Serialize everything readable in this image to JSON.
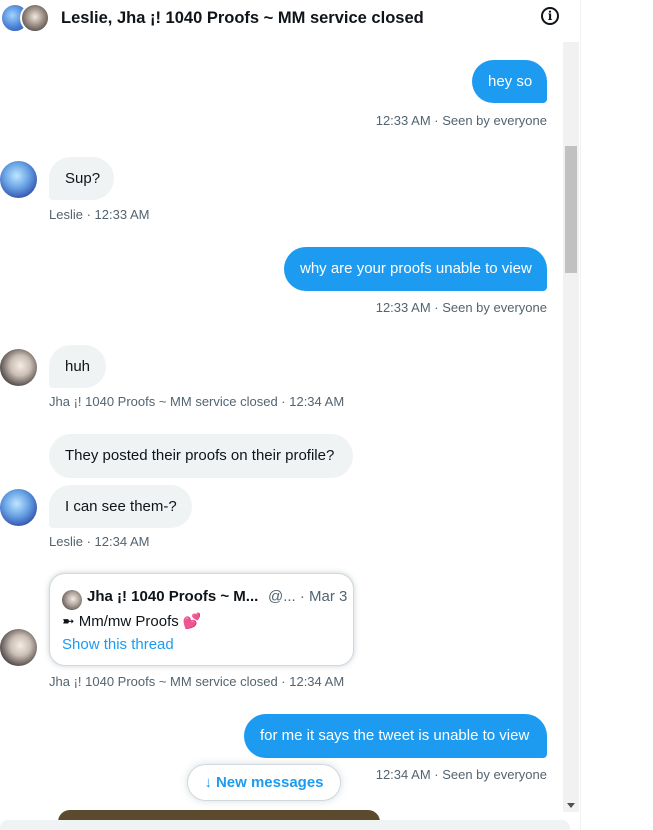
{
  "header": {
    "title": "Leslie, Jha ¡! 1040 Proofs ~ MM service closed",
    "info_icon": "info-icon",
    "info_glyph": "i"
  },
  "messages": [
    {
      "id": "m1",
      "direction": "out",
      "text": "hey so",
      "meta": "12:33 AM · Seen by everyone"
    },
    {
      "id": "m2",
      "direction": "in",
      "sender": "Leslie",
      "text": "Sup?",
      "meta": "Leslie · 12:33 AM"
    },
    {
      "id": "m3",
      "direction": "out",
      "text": "why are your proofs unable to view",
      "meta": "12:33 AM · Seen by everyone"
    },
    {
      "id": "m4",
      "direction": "in",
      "sender": "Jha",
      "text": "huh",
      "meta": "Jha ¡! 1040 Proofs ~ MM service closed · 12:34 AM"
    },
    {
      "id": "m5",
      "direction": "in",
      "sender": "Leslie",
      "text": "They posted their proofs on their profile?"
    },
    {
      "id": "m6",
      "direction": "in",
      "sender": "Leslie",
      "text": "I can see them-?",
      "meta": "Leslie · 12:34 AM"
    },
    {
      "id": "m7",
      "direction": "in",
      "sender": "Jha",
      "type": "tweet-card",
      "card": {
        "name": "Jha ¡! 1040 Proofs ~ M...",
        "handle": "@... · Mar 3",
        "text": "➼ Mm/mw Proofs",
        "emoji": "💕",
        "link": "Show this thread"
      },
      "meta": "Jha ¡! 1040 Proofs ~ MM service closed · 12:34 AM"
    },
    {
      "id": "m8",
      "direction": "out",
      "text": "for me it says the tweet is unable to view",
      "meta": "12:34 AM · Seen by everyone"
    }
  ],
  "new_messages_button": {
    "arrow": "↓",
    "label": "New messages"
  },
  "colors": {
    "accent": "#1d9bf0",
    "incoming_bubble": "#eff3f4",
    "meta_text": "#536471",
    "text": "#0f1419"
  }
}
